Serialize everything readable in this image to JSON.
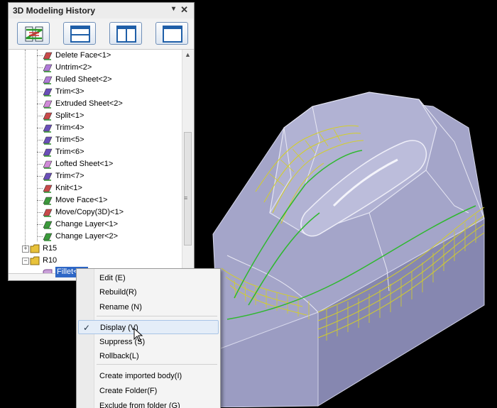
{
  "panel": {
    "title": "3D Modeling History",
    "pin_glyph": "▾",
    "close_glyph": "✕",
    "toolbar": [
      {
        "name": "history-order-icon"
      },
      {
        "name": "split-horizontal-icon"
      },
      {
        "name": "split-vertical-icon"
      },
      {
        "name": "single-view-icon"
      }
    ],
    "tree": {
      "items": [
        {
          "label": "Delete Face<1>",
          "icon": "delete-face-icon",
          "color": "#c84a4a"
        },
        {
          "label": "Untrim<2>",
          "icon": "untrim-icon",
          "color": "#b07ad8"
        },
        {
          "label": "Ruled Sheet<2>",
          "icon": "ruled-sheet-icon",
          "color": "#b07ad8"
        },
        {
          "label": "Trim<3>",
          "icon": "trim-icon",
          "color": "#6a4fb8"
        },
        {
          "label": "Extruded Sheet<2>",
          "icon": "extruded-sheet-icon",
          "color": "#d08ad8"
        },
        {
          "label": "Split<1>",
          "icon": "split-icon",
          "color": "#c84a4a"
        },
        {
          "label": "Trim<4>",
          "icon": "trim-icon",
          "color": "#6a4fb8"
        },
        {
          "label": "Trim<5>",
          "icon": "trim-icon",
          "color": "#6a4fb8"
        },
        {
          "label": "Trim<6>",
          "icon": "trim-icon",
          "color": "#6a4fb8"
        },
        {
          "label": "Lofted Sheet<1>",
          "icon": "lofted-sheet-icon",
          "color": "#d08ad8"
        },
        {
          "label": "Trim<7>",
          "icon": "trim-icon",
          "color": "#6a4fb8"
        },
        {
          "label": "Knit<1>",
          "icon": "knit-icon",
          "color": "#c84a4a"
        },
        {
          "label": "Move Face<1>",
          "icon": "move-face-icon",
          "color": "#3a9a3a"
        },
        {
          "label": "Move/Copy(3D)<1>",
          "icon": "move-copy-icon",
          "color": "#c84a4a"
        },
        {
          "label": "Change Layer<1>",
          "icon": "change-layer-icon",
          "color": "#3a9a3a"
        },
        {
          "label": "Change Layer<2>",
          "icon": "change-layer-icon",
          "color": "#3a9a3a"
        }
      ],
      "folders": [
        {
          "label": "R15",
          "expand": "+"
        },
        {
          "label": "R10",
          "expand": "−"
        }
      ],
      "selected": "Fillet<1>"
    },
    "scroll_up": "▲",
    "scroll_grip": "≡"
  },
  "context_menu": {
    "items": [
      {
        "label": "Edit (E)"
      },
      {
        "label": "Rebuild(R)"
      },
      {
        "label": "Rename (N)"
      },
      {
        "label": "Display (V)",
        "checked": true,
        "check": "✓"
      },
      {
        "label": "Suppress (S)"
      },
      {
        "label": "Rollback(L)"
      },
      {
        "label": "Create imported body(I)"
      },
      {
        "label": "Create Folder(F)"
      },
      {
        "label": "Exclude from folder (G)"
      }
    ]
  },
  "colors": {
    "model_top": "#a3a4c8",
    "model_side": "#8b8cb4",
    "model_front": "#9fa0c4",
    "fillet_mesh": "#d4cf28",
    "curve_green": "#2eb82e",
    "selection": "#2e67c6"
  }
}
